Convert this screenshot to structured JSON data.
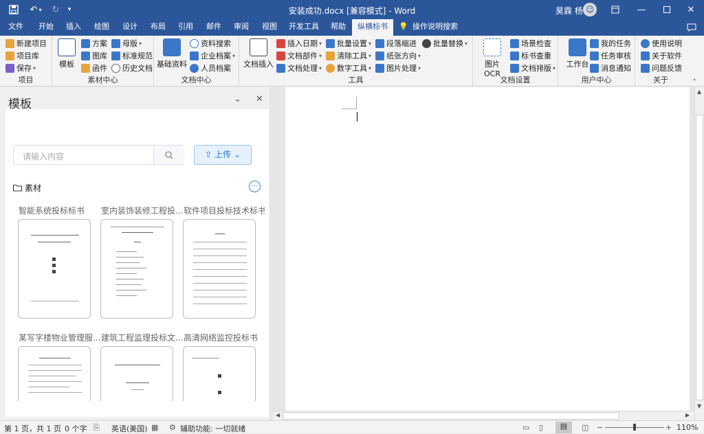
{
  "title": "安装成功.docx [兼容模式] - Word",
  "user": "昊霖 杨",
  "tabs": [
    "文件",
    "开始",
    "插入",
    "绘图",
    "设计",
    "布局",
    "引用",
    "邮件",
    "审阅",
    "视图",
    "开发工具",
    "帮助",
    "纵横标书"
  ],
  "tell_me": "操作说明搜索",
  "ribbon": {
    "project": {
      "label": "项目",
      "items": [
        "新建项目",
        "项目库",
        "保存"
      ]
    },
    "material": {
      "label": "素材中心",
      "big": "模板",
      "items": [
        "方案",
        "母版",
        "图库",
        "标准规范",
        "函件",
        "历史文档"
      ]
    },
    "docs": {
      "label": "文档中心",
      "big": "基础资料",
      "items": [
        "资料搜索",
        "企业档案",
        "人员档案"
      ]
    },
    "tools": {
      "label": "工具",
      "big": "文档插入",
      "items": [
        "插入日期",
        "批量设置",
        "段落缩进",
        "批量替换",
        "文档部件",
        "清除工具",
        "纸张方向",
        "文档处理",
        "数字工具",
        "图片处理"
      ]
    },
    "docset": {
      "label": "文档设置",
      "big": "图片OCR",
      "items": [
        "场景检查",
        "标书查重",
        "文档排版"
      ]
    },
    "user_center": {
      "label": "用户中心",
      "big": "工作台",
      "items": [
        "我的任务",
        "任务审核",
        "消息通知"
      ]
    },
    "about": {
      "label": "关于",
      "items": [
        "使用说明",
        "关于软件",
        "问题反馈"
      ]
    }
  },
  "panel": {
    "title": "模板",
    "search_placeholder": "请输入内容",
    "upload": "上传",
    "folder": "素材",
    "templates": [
      "智能系统投标标书",
      "室内装饰装修工程投...",
      "软件项目投标技术标书",
      "某写字楼物业管理服...",
      "建筑工程监理投标文...",
      "高清网络监控投标书"
    ]
  },
  "status": {
    "page": "第 1 页，共 1 页",
    "words": "0 个字",
    "lang": "英语(美国)",
    "access": "辅助功能: 一切就绪",
    "zoom": "110%"
  },
  "colors": {
    "brand": "#2b579a",
    "accent": "#1f78d1"
  }
}
